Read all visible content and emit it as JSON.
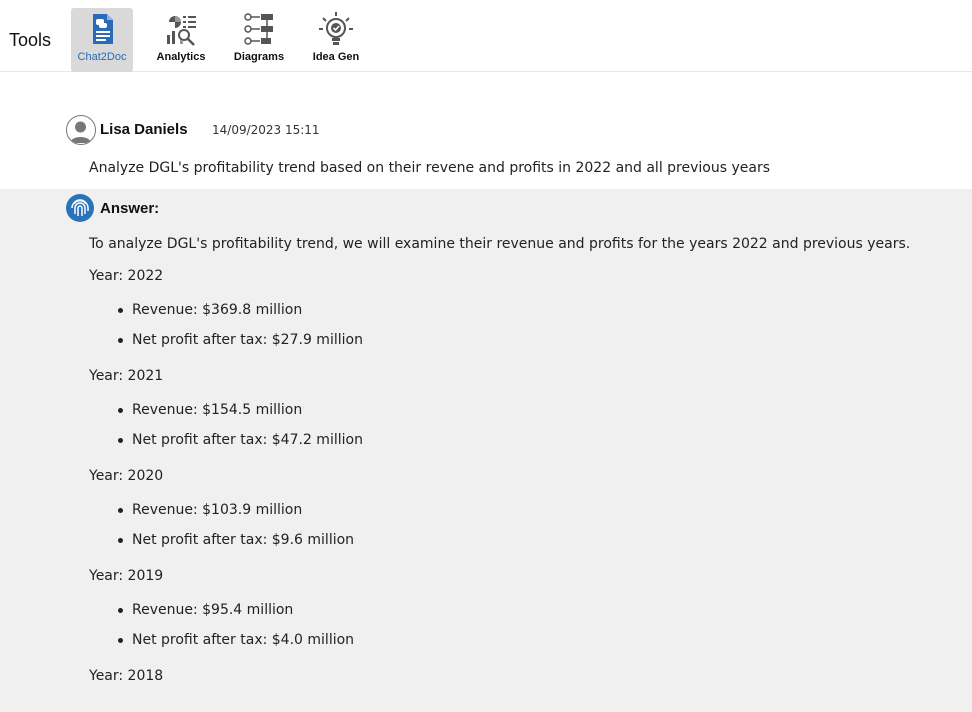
{
  "toolbar": {
    "title": "Tools",
    "tools": [
      {
        "label": "Chat2Doc",
        "icon": "document-chat-icon",
        "active": true
      },
      {
        "label": "Analytics",
        "icon": "analytics-icon",
        "active": false
      },
      {
        "label": "Diagrams",
        "icon": "diagram-flow-icon",
        "active": false
      },
      {
        "label": "Idea Gen",
        "icon": "lightbulb-icon",
        "active": false
      }
    ]
  },
  "message": {
    "user_name": "Lisa Daniels",
    "timestamp": "14/09/2023 15:11",
    "text": "Analyze DGL's profitability trend based on their revene and profits in 2022 and all previous years",
    "avatar_icon": "user-avatar-icon"
  },
  "answer": {
    "heading": "Answer:",
    "icon": "fingerprint-icon",
    "intro": "To analyze DGL's profitability trend, we will examine their revenue and profits for the years 2022 and previous years.",
    "years": [
      {
        "label": "Year: 2022",
        "revenue": "Revenue: $369.8 million",
        "profit": "Net profit after tax: $27.9 million"
      },
      {
        "label": "Year: 2021",
        "revenue": "Revenue: $154.5 million",
        "profit": "Net profit after tax: $47.2 million"
      },
      {
        "label": "Year: 2020",
        "revenue": "Revenue: $103.9 million",
        "profit": "Net profit after tax: $9.6 million"
      },
      {
        "label": "Year: 2019",
        "revenue": "Revenue: $95.4 million",
        "profit": "Net profit after tax: $4.0 million"
      },
      {
        "label": "Year: 2018"
      }
    ]
  },
  "colors": {
    "accent": "#2a6ab8",
    "answer_background": "#f0f0f0",
    "active_tool_background": "#d9d9d9"
  }
}
